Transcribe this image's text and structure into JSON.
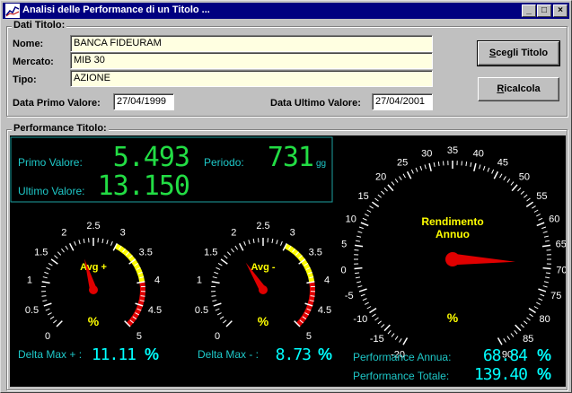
{
  "window": {
    "title": "Analisi delle Performance di un Titolo ..."
  },
  "dati": {
    "group_label": "Dati Titolo:",
    "nome_label": "Nome:",
    "nome_value": "BANCA FIDEURAM",
    "mercato_label": "Mercato:",
    "mercato_value": "MIB 30",
    "tipo_label": "Tipo:",
    "tipo_value": "AZIONE",
    "primo_label": "Data Primo Valore:",
    "primo_value": "27/04/1999",
    "ultimo_label": "Data Ultimo Valore:",
    "ultimo_value": "27/04/2001"
  },
  "buttons": {
    "scegli_accel": "S",
    "scegli_rest": "cegli Titolo",
    "ricalcola_accel": "R",
    "ricalcola_rest": "icalcola"
  },
  "performance": {
    "group_label": "Performance Titolo:",
    "primo_label": "Primo Valore:",
    "primo_value": "5.493",
    "ultimo_label": "Ultimo Valore:",
    "ultimo_value": "13.150",
    "periodo_label": "Periodo:",
    "periodo_value": "731",
    "periodo_unit": "gg",
    "delta_plus_label": "Delta Max + :",
    "delta_plus_value": "11.11",
    "delta_plus_unit": "%",
    "delta_minus_label": "Delta Max - :",
    "delta_minus_value": "8.73",
    "delta_minus_unit": "%",
    "annua_label": "Performance Annua:",
    "annua_value": "68.84",
    "annua_unit": "%",
    "totale_label": "Performance Totale:",
    "totale_value": "139.40",
    "totale_unit": "%"
  },
  "gauges": {
    "avg_plus": {
      "title": "Avg +",
      "unit": "%",
      "ticks": [
        "0",
        "0.5",
        "1",
        "1.5",
        "2",
        "2.5",
        "3",
        "3.5",
        "4",
        "4.5",
        "5"
      ],
      "needle_value": 2.2
    },
    "avg_minus": {
      "title": "Avg -",
      "unit": "%",
      "ticks": [
        "0",
        "0.5",
        "1",
        "1.5",
        "2",
        "2.5",
        "3",
        "3.5",
        "4",
        "4.5",
        "5"
      ],
      "needle_value": 1.9
    },
    "rendimento": {
      "title_line1": "Rendimento",
      "title_line2": "Annuo",
      "unit": "%",
      "ticks": [
        "-20",
        "-15",
        "-10",
        "-5",
        "0",
        "5",
        "10",
        "15",
        "20",
        "25",
        "30",
        "35",
        "40",
        "45",
        "50",
        "55",
        "60",
        "65",
        "70",
        "75",
        "80",
        "85",
        "90"
      ],
      "needle_value": 68.84
    }
  },
  "colors": {
    "titlebar": "#000080",
    "panel_bg": "#000000",
    "led_green": "#22dd44",
    "label_cyan": "#1ec8c8",
    "value_cyan": "#00ffff",
    "gauge_yellow": "#ffff00",
    "gauge_red": "#e00000",
    "needle": "#e00000"
  }
}
